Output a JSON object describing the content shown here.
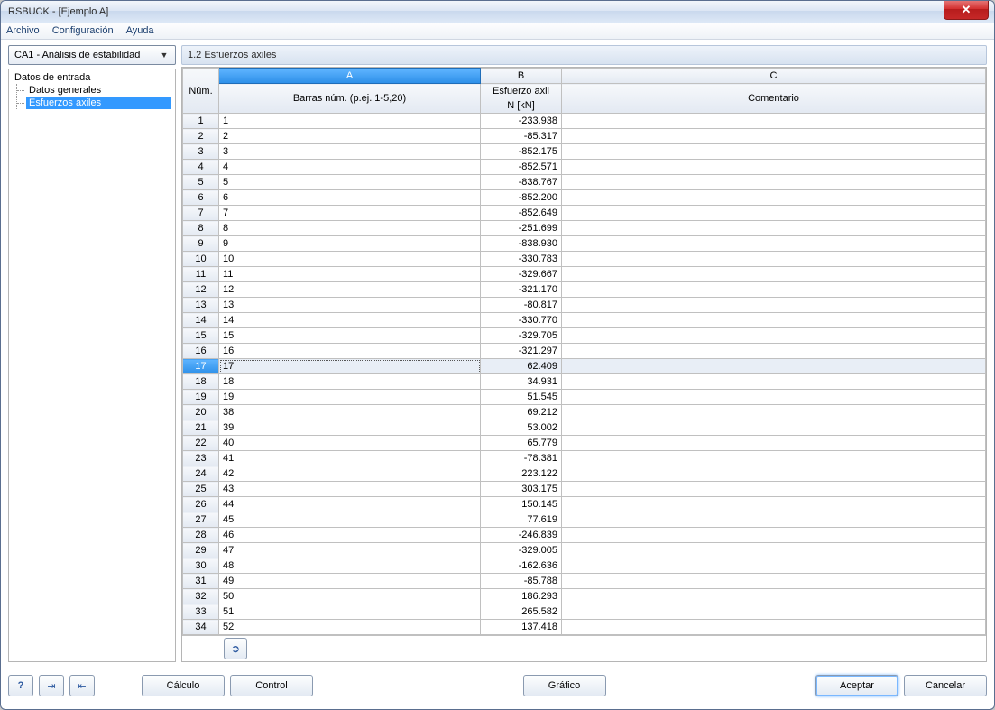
{
  "window": {
    "title": "RSBUCK - [Ejemplo A]"
  },
  "menu": {
    "file": "Archivo",
    "config": "Configuración",
    "help": "Ayuda"
  },
  "combo": {
    "value": "CA1 - Análisis de estabilidad"
  },
  "tree": {
    "root": "Datos de entrada",
    "items": [
      {
        "label": "Datos generales",
        "selected": false
      },
      {
        "label": "Esfuerzos axiles",
        "selected": true
      }
    ]
  },
  "section": {
    "title": "1.2 Esfuerzos axiles"
  },
  "grid": {
    "letters": [
      "A",
      "B",
      "C"
    ],
    "selected_letter_index": 0,
    "header_num": "Núm.",
    "header_A": "Barras núm. (p.ej. 1-5,20)",
    "header_B1": "Esfuerzo axil",
    "header_B2": "N [kN]",
    "header_C": "Comentario",
    "selected_row_index": 16,
    "rows": [
      {
        "num": "1",
        "a": "1",
        "b": "-233.938",
        "c": ""
      },
      {
        "num": "2",
        "a": "2",
        "b": "-85.317",
        "c": ""
      },
      {
        "num": "3",
        "a": "3",
        "b": "-852.175",
        "c": ""
      },
      {
        "num": "4",
        "a": "4",
        "b": "-852.571",
        "c": ""
      },
      {
        "num": "5",
        "a": "5",
        "b": "-838.767",
        "c": ""
      },
      {
        "num": "6",
        "a": "6",
        "b": "-852.200",
        "c": ""
      },
      {
        "num": "7",
        "a": "7",
        "b": "-852.649",
        "c": ""
      },
      {
        "num": "8",
        "a": "8",
        "b": "-251.699",
        "c": ""
      },
      {
        "num": "9",
        "a": "9",
        "b": "-838.930",
        "c": ""
      },
      {
        "num": "10",
        "a": "10",
        "b": "-330.783",
        "c": ""
      },
      {
        "num": "11",
        "a": "11",
        "b": "-329.667",
        "c": ""
      },
      {
        "num": "12",
        "a": "12",
        "b": "-321.170",
        "c": ""
      },
      {
        "num": "13",
        "a": "13",
        "b": "-80.817",
        "c": ""
      },
      {
        "num": "14",
        "a": "14",
        "b": "-330.770",
        "c": ""
      },
      {
        "num": "15",
        "a": "15",
        "b": "-329.705",
        "c": ""
      },
      {
        "num": "16",
        "a": "16",
        "b": "-321.297",
        "c": ""
      },
      {
        "num": "17",
        "a": "17",
        "b": "62.409",
        "c": ""
      },
      {
        "num": "18",
        "a": "18",
        "b": "34.931",
        "c": ""
      },
      {
        "num": "19",
        "a": "19",
        "b": "51.545",
        "c": ""
      },
      {
        "num": "20",
        "a": "38",
        "b": "69.212",
        "c": ""
      },
      {
        "num": "21",
        "a": "39",
        "b": "53.002",
        "c": ""
      },
      {
        "num": "22",
        "a": "40",
        "b": "65.779",
        "c": ""
      },
      {
        "num": "23",
        "a": "41",
        "b": "-78.381",
        "c": ""
      },
      {
        "num": "24",
        "a": "42",
        "b": "223.122",
        "c": ""
      },
      {
        "num": "25",
        "a": "43",
        "b": "303.175",
        "c": ""
      },
      {
        "num": "26",
        "a": "44",
        "b": "150.145",
        "c": ""
      },
      {
        "num": "27",
        "a": "45",
        "b": "77.619",
        "c": ""
      },
      {
        "num": "28",
        "a": "46",
        "b": "-246.839",
        "c": ""
      },
      {
        "num": "29",
        "a": "47",
        "b": "-329.005",
        "c": ""
      },
      {
        "num": "30",
        "a": "48",
        "b": "-162.636",
        "c": ""
      },
      {
        "num": "31",
        "a": "49",
        "b": "-85.788",
        "c": ""
      },
      {
        "num": "32",
        "a": "50",
        "b": "186.293",
        "c": ""
      },
      {
        "num": "33",
        "a": "51",
        "b": "265.582",
        "c": ""
      },
      {
        "num": "34",
        "a": "52",
        "b": "137.418",
        "c": ""
      }
    ]
  },
  "buttons": {
    "calculo": "Cálculo",
    "control": "Control",
    "grafico": "Gráfico",
    "aceptar": "Aceptar",
    "cancelar": "Cancelar"
  },
  "icons": {
    "help": "?",
    "import": "⇥",
    "export": "⇤",
    "pick": "➲"
  }
}
